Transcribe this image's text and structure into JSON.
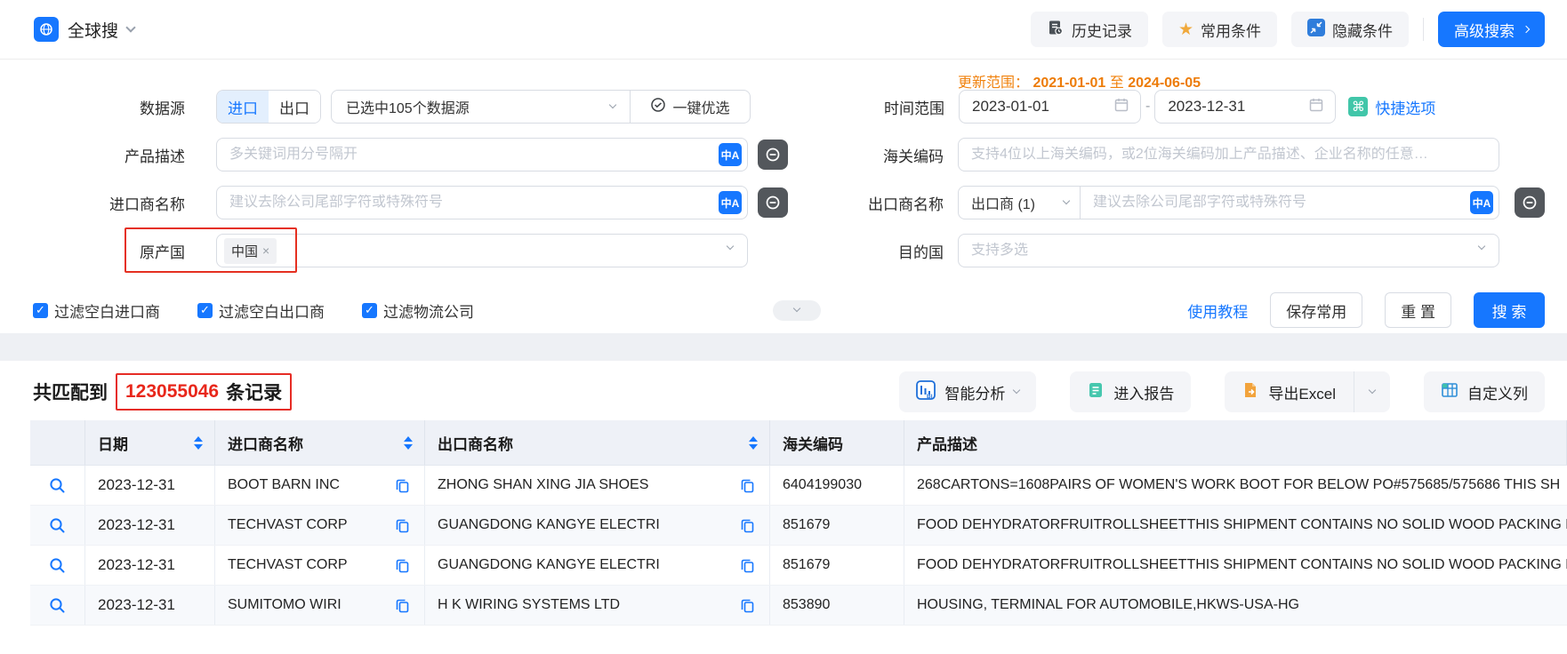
{
  "icons": {
    "translate": "中A",
    "command": "⌘",
    "star": "★",
    "check": "✓",
    "close": "×"
  },
  "topbar": {
    "app_title": "全球搜",
    "buttons": {
      "history": "历史记录",
      "favorites": "常用条件",
      "hide": "隐藏条件",
      "advanced": "高级搜索"
    }
  },
  "form": {
    "datasource": {
      "label": "数据源",
      "tab_import": "进口",
      "tab_export": "出口",
      "selected_text": "已选中105个数据源",
      "optimize_label": "一键优选"
    },
    "update_range": {
      "label": "更新范围：",
      "start": "2021-01-01",
      "to": "至",
      "end": "2024-06-05"
    },
    "time_range": {
      "label": "时间范围",
      "start": "2023-01-01",
      "separator": "-",
      "end": "2023-12-31",
      "quick_label": "快捷选项"
    },
    "product_desc": {
      "label": "产品描述",
      "placeholder": "多关键词用分号隔开"
    },
    "hs_code": {
      "label": "海关编码",
      "placeholder": "支持4位以上海关编码，或2位海关编码加上产品描述、企业名称的任意…"
    },
    "importer": {
      "label": "进口商名称",
      "placeholder": "建议去除公司尾部字符或特殊符号"
    },
    "exporter": {
      "label": "出口商名称",
      "selector_value": "出口商 (1)",
      "placeholder": "建议去除公司尾部字符或特殊符号"
    },
    "origin_country": {
      "label": "原产国",
      "tag": "中国"
    },
    "destination": {
      "label": "目的国",
      "placeholder": "支持多选"
    },
    "filters": [
      "过滤空白进口商",
      "过滤空白出口商",
      "过滤物流公司"
    ],
    "tutorial_link": "使用教程",
    "save_button": "保存常用",
    "reset_button": "重 置",
    "search_button": "搜 索"
  },
  "results": {
    "match_prefix": "共匹配到",
    "count": "123055046",
    "match_suffix": "条记录",
    "buttons": {
      "analyze": "智能分析",
      "report": "进入报告",
      "export": "导出Excel",
      "columns": "自定义列"
    }
  },
  "table": {
    "headers": {
      "date": "日期",
      "importer": "进口商名称",
      "exporter": "出口商名称",
      "hs_code": "海关编码",
      "product": "产品描述"
    },
    "rows": [
      {
        "date": "2023-12-31",
        "importer": "BOOT BARN INC",
        "exporter": "ZHONG SHAN XING JIA SHOES",
        "hs_code": "6404199030",
        "product": "268CARTONS=1608PAIRS OF WOMEN'S WORK BOOT FOR BELOW PO#575685/575686 THIS SH"
      },
      {
        "date": "2023-12-31",
        "importer": "TECHVAST CORP",
        "exporter": "GUANGDONG KANGYE ELECTRI",
        "hs_code": "851679",
        "product": "FOOD DEHYDRATORFRUITROLLSHEETTHIS SHIPMENT CONTAINS NO SOLID WOOD PACKING N"
      },
      {
        "date": "2023-12-31",
        "importer": "TECHVAST CORP",
        "exporter": "GUANGDONG KANGYE ELECTRI",
        "hs_code": "851679",
        "product": "FOOD DEHYDRATORFRUITROLLSHEETTHIS SHIPMENT CONTAINS NO SOLID WOOD PACKING N"
      },
      {
        "date": "2023-12-31",
        "importer": "SUMITOMO WIRI",
        "exporter": "H K WIRING SYSTEMS LTD",
        "hs_code": "853890",
        "product": "HOUSING, TERMINAL FOR AUTOMOBILE,HKWS-USA-HG"
      }
    ]
  }
}
